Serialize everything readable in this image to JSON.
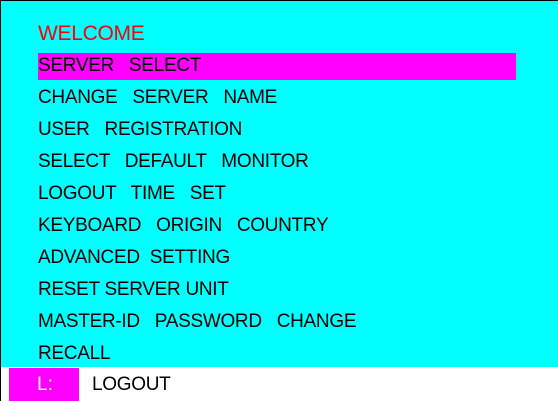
{
  "osd": {
    "title": "WELCOME",
    "selected_index": 0,
    "menu": [
      "SERVER   SELECT",
      "CHANGE   SERVER   NAME",
      "USER   REGISTRATION",
      "SELECT   DEFAULT   MONITOR",
      "LOGOUT   TIME   SET",
      "KEYBOARD   ORIGIN   COUNTRY",
      "ADVANCED  SETTING",
      "RESET SERVER UNIT",
      "MASTER-ID   PASSWORD   CHANGE",
      "RECALL"
    ]
  },
  "statusbar": {
    "key": "L:",
    "label": "LOGOUT"
  },
  "colors": {
    "background": "#00ffff",
    "highlight": "#ff00ff",
    "title": "#ff0000",
    "text": "#000000"
  }
}
